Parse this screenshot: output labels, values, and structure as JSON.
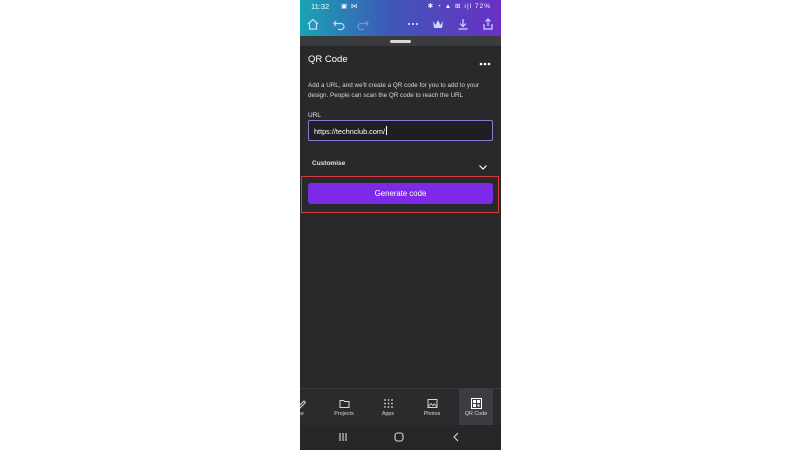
{
  "status_bar": {
    "time": "11:32",
    "left_icons": "▣ ⋈",
    "right_icons": "✱ ◔ ▲ ⊞ ı|l",
    "battery": "72%"
  },
  "panel": {
    "title": "QR Code",
    "description": "Add a URL, and we'll create a QR code for you to add to your design. People can scan the QR code to reach the URL",
    "url_label": "URL",
    "url_value": "https://technclub.com/",
    "customise_label": "Customise",
    "generate_label": "Generate code"
  },
  "bottom_nav": {
    "partial": "se",
    "projects": "Projects",
    "apps": "Apps",
    "photos": "Photos",
    "qr_code": "QR Code"
  },
  "colors": {
    "accent": "#7d2ae8",
    "highlight": "#d63a3a",
    "panel_bg": "#28292b"
  }
}
